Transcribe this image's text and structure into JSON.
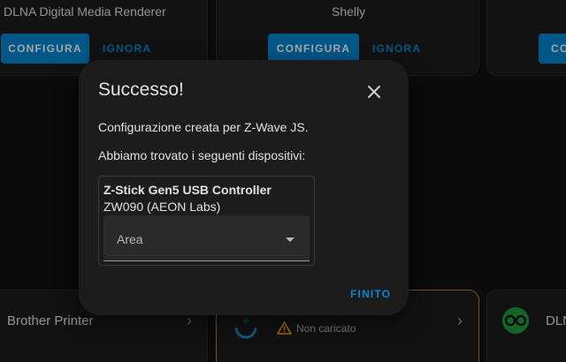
{
  "top_cards": [
    {
      "title": "DLNA Digital Media Renderer",
      "configure_label": "CONFIGURA",
      "ignore_label": "IGNORA"
    },
    {
      "title": "Shelly",
      "configure_label": "CONFIGURA",
      "ignore_label": "IGNORA"
    },
    {
      "title": "",
      "configure_label": "CO"
    }
  ],
  "bottom_cards": [
    {
      "title": "Brother Printer"
    },
    {
      "status": "Non caricato"
    },
    {
      "title": "DLN"
    }
  ],
  "dialog": {
    "title": "Successo!",
    "message": "Configurazione creata per Z-Wave JS.",
    "devices_intro": "Abbiamo trovato i seguenti dispositivi:",
    "device": {
      "name": "Z-Stick Gen5 USB Controller",
      "model": "ZW090 (AEON Labs)",
      "area_placeholder": "Area"
    },
    "finish_label": "FINITO"
  },
  "colors": {
    "accent": "#0288d1",
    "warning": "#ffa600",
    "integration_green": "#1f9d3c"
  },
  "icons": {
    "close": "close-icon",
    "chevron": "chevron-right-icon",
    "warning": "warning-icon",
    "dlna": "dlna-logo-icon",
    "home_assistant": "home-assistant-logo-icon"
  }
}
